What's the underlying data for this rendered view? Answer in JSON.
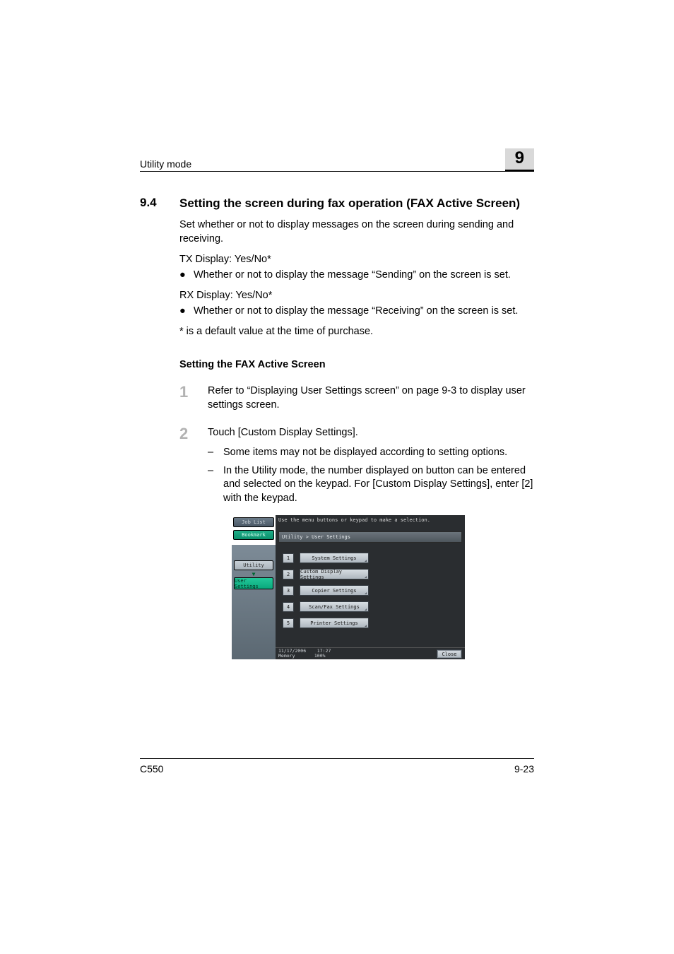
{
  "header": {
    "running_head": "Utility mode",
    "chapter_number": "9"
  },
  "section": {
    "number": "9.4",
    "title": "Setting the screen during fax operation (FAX Active Screen)"
  },
  "intro": "Set whether or not to display messages on the screen during sending and receiving.",
  "tx_line": "TX Display: Yes/No*",
  "tx_bullet": "Whether or not to display the message “Sending” on the screen is set.",
  "rx_line": "RX Display: Yes/No*",
  "rx_bullet": "Whether or not to display the message “Receiving” on the screen is set.",
  "default_note": "* is a default value at the time of purchase.",
  "subheading": "Setting the FAX Active Screen",
  "steps": [
    {
      "n": "1",
      "text": "Refer to “Displaying User Settings screen” on page 9-3 to display user settings screen."
    },
    {
      "n": "2",
      "text": "Touch [Custom Display Settings]."
    }
  ],
  "notes": [
    "Some items may not be displayed according to setting options.",
    "In the Utility mode, the number displayed on button can be entered and selected on the keypad. For [Custom Display Settings], enter [2] with the keypad."
  ],
  "screenshot": {
    "left": {
      "job_list": "Job List",
      "bookmark": "Bookmark",
      "utility": "Utility",
      "arrow": "▼",
      "user_settings": "User Settings"
    },
    "instruction": "Use the menu buttons or keypad to make a selection.",
    "breadcrumb": "Utility > User Settings",
    "menu": [
      {
        "n": "1",
        "label": "System Settings"
      },
      {
        "n": "2",
        "label": "Custom Display Settings"
      },
      {
        "n": "3",
        "label": "Copier Settings"
      },
      {
        "n": "4",
        "label": "Scan/Fax Settings"
      },
      {
        "n": "5",
        "label": "Printer Settings"
      }
    ],
    "footer": {
      "date": "11/17/2006",
      "time": "17:27",
      "mem_label": "Memory",
      "mem_value": "100%",
      "close": "Close"
    }
  },
  "page_footer": {
    "model": "C550",
    "page": "9-23"
  }
}
